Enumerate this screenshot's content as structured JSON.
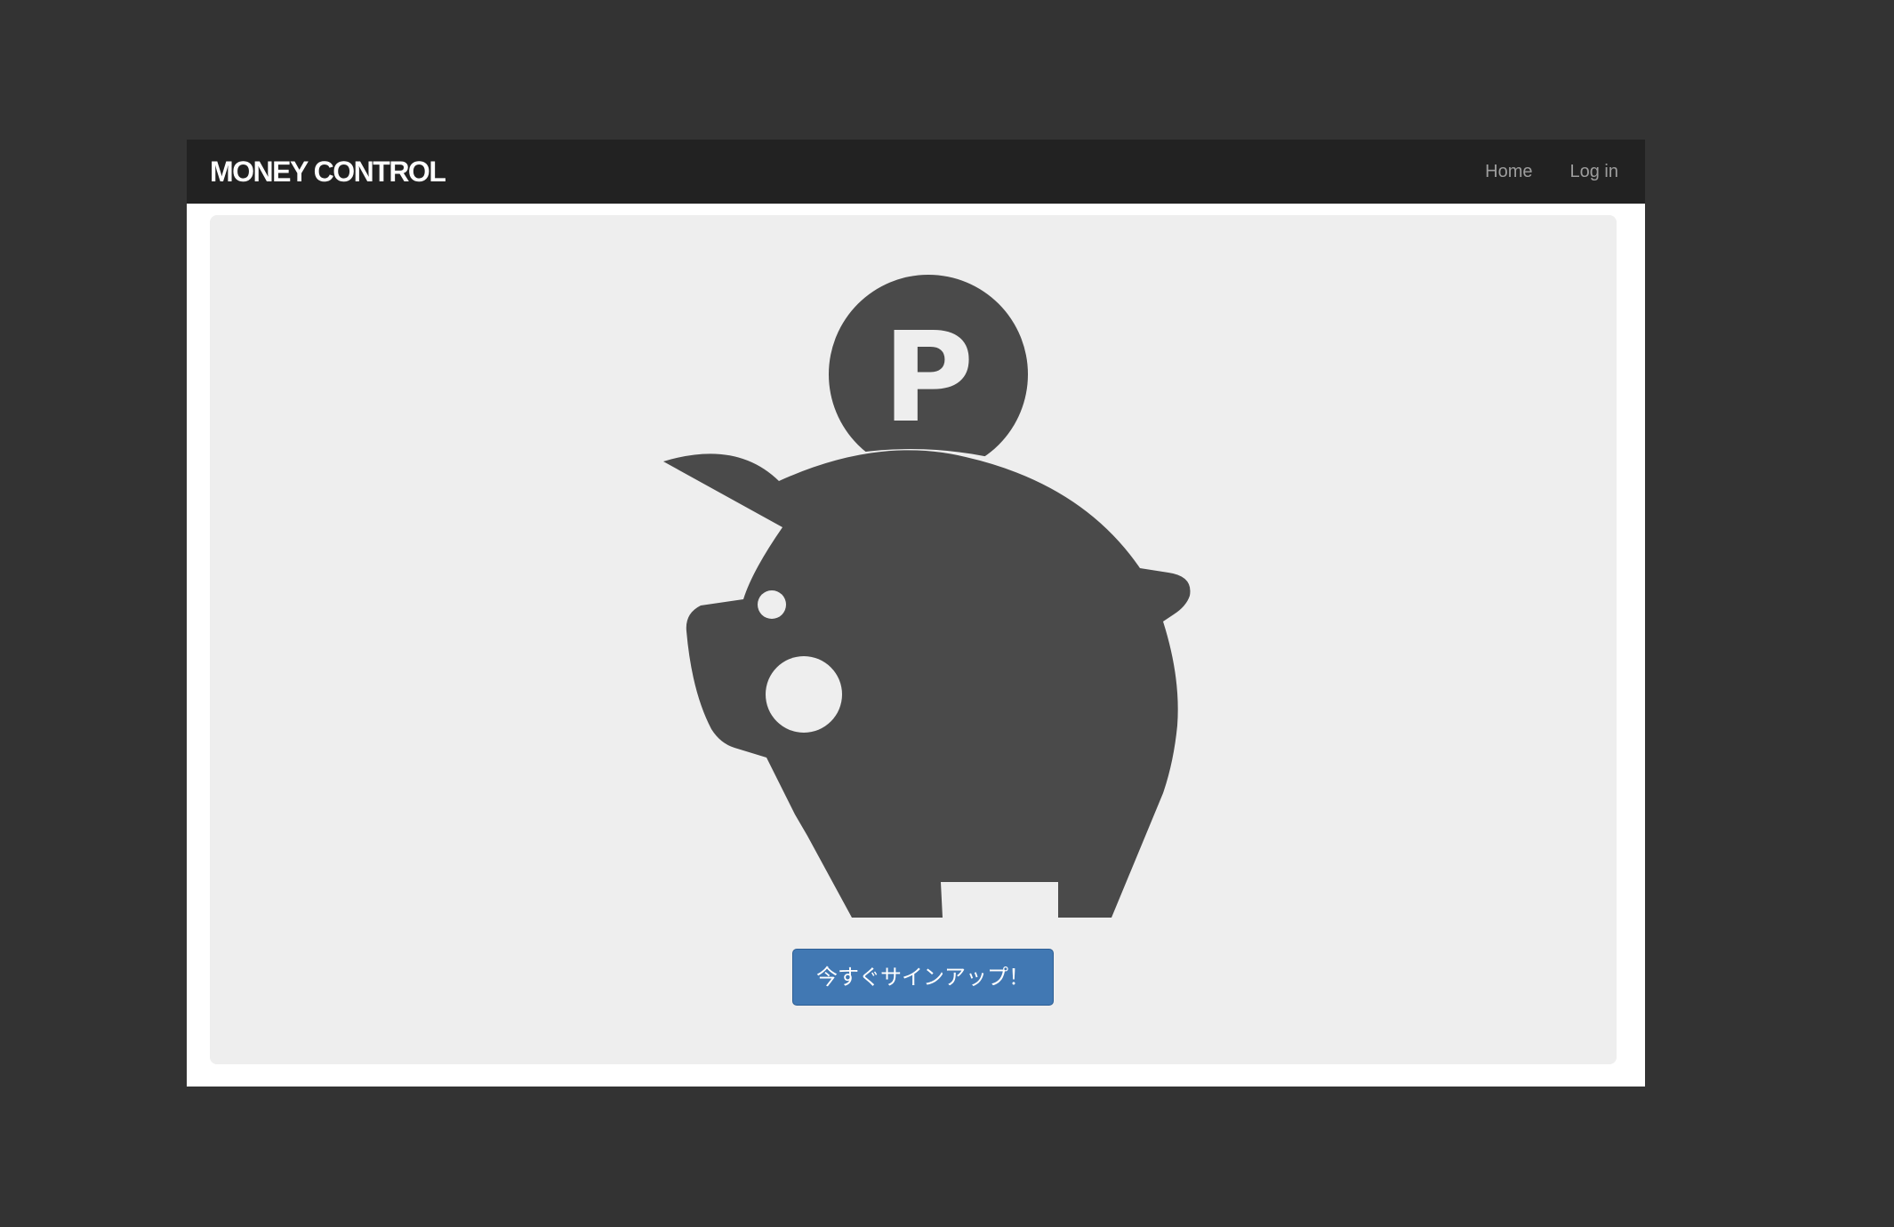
{
  "navbar": {
    "brand": "MONEY CONTROL",
    "links": [
      "Home",
      "Log in"
    ]
  },
  "hero": {
    "icon": "piggy-bank-with-coin-icon",
    "coin_letter": "P",
    "icon_color": "#4a4a4a"
  },
  "cta": {
    "label": "今すぐサインアップ！",
    "color": "#4178b3"
  },
  "colors": {
    "background": "#333333",
    "navbar": "#222222",
    "jumbotron": "#eeeeee"
  }
}
